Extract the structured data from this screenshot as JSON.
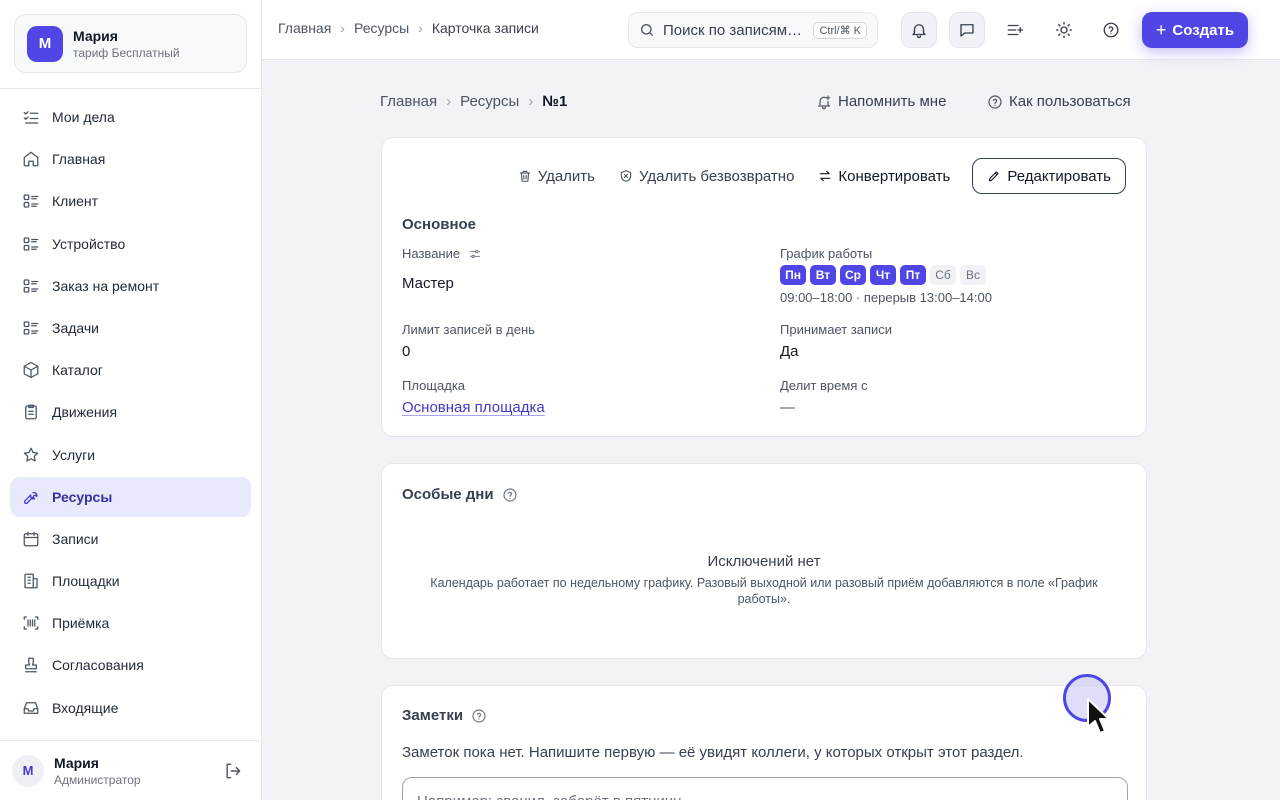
{
  "org": {
    "avatar": "М",
    "name": "Мария",
    "plan": "тариф Бесплатный"
  },
  "sidebar": {
    "items": [
      {
        "label": "Мои дела",
        "icon": "checklist-icon"
      },
      {
        "label": "Главная",
        "icon": "home-icon"
      },
      {
        "label": "Клиент",
        "icon": "list-icon"
      },
      {
        "label": "Устройство",
        "icon": "list-icon"
      },
      {
        "label": "Заказ на ремонт",
        "icon": "list-icon"
      },
      {
        "label": "Задачи",
        "icon": "list-icon"
      },
      {
        "label": "Каталог",
        "icon": "box-icon"
      },
      {
        "label": "Движения",
        "icon": "clipboard-icon"
      },
      {
        "label": "Услуги",
        "icon": "star-icon"
      },
      {
        "label": "Ресурсы",
        "icon": "wrench-icon",
        "active": true
      },
      {
        "label": "Записи",
        "icon": "calendar-icon"
      },
      {
        "label": "Площадки",
        "icon": "building-icon"
      },
      {
        "label": "Приёмка",
        "icon": "scan-icon"
      },
      {
        "label": "Согласования",
        "icon": "stamp-icon"
      },
      {
        "label": "Входящие",
        "icon": "inbox-icon"
      }
    ]
  },
  "user": {
    "avatar": "М",
    "name": "Мария",
    "role": "Администратор"
  },
  "topbar": {
    "breadcrumbs": [
      "Главная",
      "Ресурсы",
      "Карточка записи"
    ],
    "search_placeholder": "Поиск по записям…",
    "search_hotkey": "Ctrl/⌘ K",
    "create_label": "Создать"
  },
  "page": {
    "breadcrumbs": [
      "Главная",
      "Ресурсы",
      "№1"
    ],
    "remind_label": "Напомнить мне",
    "howto_label": "Как пользоваться"
  },
  "actions": {
    "delete": "Удалить",
    "delete_forever": "Удалить безвозвратно",
    "convert": "Конвертировать",
    "edit": "Редактировать"
  },
  "main_section": {
    "title": "Основное",
    "name_label": "Название",
    "name_value": "Мастер",
    "schedule_label": "График работы",
    "days": [
      {
        "label": "Пн",
        "on": true
      },
      {
        "label": "Вт",
        "on": true
      },
      {
        "label": "Ср",
        "on": true
      },
      {
        "label": "Чт",
        "on": true
      },
      {
        "label": "Пт",
        "on": true
      },
      {
        "label": "Сб",
        "on": false
      },
      {
        "label": "Вс",
        "on": false
      }
    ],
    "hours": "09:00–18:00 · перерыв 13:00–14:00",
    "limit_label": "Лимит записей в день",
    "limit_value": "0",
    "accepts_label": "Принимает записи",
    "accepts_value": "Да",
    "site_label": "Площадка",
    "site_value": "Основная площадка",
    "shares_label": "Делит время с",
    "shares_value": "—"
  },
  "special_days": {
    "title": "Особые дни",
    "empty_title": "Исключений нет",
    "empty_desc": "Календарь работает по недельному графику. Разовый выходной или разовый приём добавляются в поле «График работы»."
  },
  "notes": {
    "title": "Заметки",
    "empty_text": "Заметок пока нет. Напишите первую — её увидят коллеги, у которых открыт этот раздел.",
    "input_placeholder": "Например: звонил, заберёт в пятницу"
  },
  "colors": {
    "accent": "#4f46e5",
    "active_bg": "#e8e9fb",
    "page_bg": "#f1f3f7"
  }
}
